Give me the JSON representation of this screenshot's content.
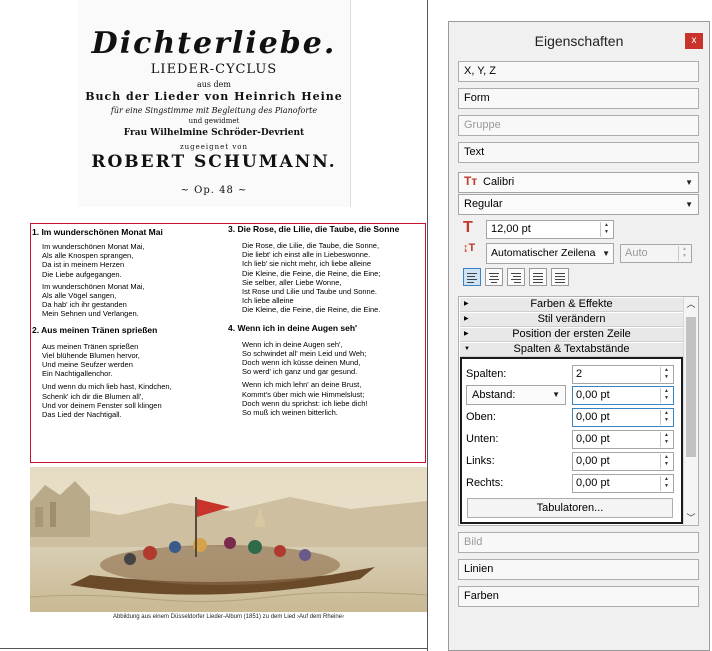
{
  "document": {
    "title_page": {
      "main_title": "Dichterliebe.",
      "subtitle": "LIEDER-CYCLUS",
      "line_aus": "aus dem",
      "book": "Buch der Lieder von Heinrich Heine",
      "voice": "für eine Singstimme mit Begleitung des Pianoforte",
      "dedication_pre": "Frau Wilhelmine Schröder-Devrient",
      "dedicated": "zugeeignet von",
      "composer": "ROBERT SCHUMANN.",
      "ornament": "~ Op. 48 ~"
    },
    "songs": [
      {
        "title": "1. Im wunderschönen Monat Mai",
        "stanzas": [
          [
            "Im wunderschönen Monat Mai,",
            "Als alle Knospen sprangen,",
            "Da ist in meinem Herzen",
            "Die Liebe aufgegangen."
          ],
          [
            "Im wunderschönen Monat Mai,",
            "Als alle Vögel sangen,",
            "Da hab' ich ihr gestanden",
            "Mein Sehnen und Verlangen."
          ]
        ]
      },
      {
        "title": "2. Aus meinen Tränen sprießen",
        "stanzas": [
          [
            "Aus meinen Tränen sprießen",
            "Viel blühende Blumen hervor,",
            "Und meine Seufzer werden",
            "Ein Nachtigallenchor."
          ],
          [
            "Und wenn du mich lieb hast, Kindchen,",
            "Schenk' ich dir die Blumen all',",
            "Und vor deinem Fenster soll klingen",
            "Das Lied der Nachtigall."
          ]
        ]
      },
      {
        "title": "3. Die Rose, die Lilie, die Taube, die Sonne",
        "stanzas": [
          [
            "Die Rose, die Lilie, die Taube, die Sonne,",
            "Die liebt' ich einst alle in Liebeswonne.",
            "Ich lieb' sie nicht mehr, ich liebe alleine",
            "Die Kleine, die Feine, die Reine, die Eine;",
            "Sie selber, aller Liebe Wonne,",
            "Ist Rose und Lilie und Taube und Sonne.",
            "Ich liebe alleine",
            "Die Kleine, die Feine, die Reine, die Eine."
          ]
        ]
      },
      {
        "title": "4. Wenn ich in deine Augen  seh'",
        "stanzas": [
          [
            "Wenn ich in deine Augen seh',",
            "So schwindet all' mein Leid und Weh;",
            "Doch wenn ich küsse deinen Mund,",
            "So werd' ich ganz und gar gesund."
          ],
          [
            "Wenn ich mich lehn' an deine Brust,",
            "Kommt's über mich wie Himmelslust;",
            "Doch wenn du sprichst: ich liebe dich!",
            "So muß ich weinen bitterlich."
          ]
        ]
      }
    ],
    "caption": "Abbildung aus einem Düsseldorfer Lieder-Album (1851) zu dem Lied ›Auf dem Rheine‹"
  },
  "panel": {
    "title": "Eigenschaften",
    "close_label": "x",
    "sections": {
      "xyz": "X, Y, Z",
      "form": "Form",
      "gruppe": "Gruppe",
      "text": "Text",
      "bild": "Bild",
      "linien": "Linien",
      "farben": "Farben"
    },
    "font_family": "Calibri",
    "font_style": "Regular",
    "font_size": "12,00 pt",
    "line_spacing_mode": "Automatischer Zeilena",
    "line_spacing_value": "Auto",
    "alignment_selected": "left",
    "accordion": {
      "items": [
        "Farben & Effekte",
        "Stil verändern",
        "Position der ersten Zeile",
        "Spalten & Textabstände"
      ],
      "expanded": "Spalten & Textabstände"
    },
    "columns": {
      "spalten_label": "Spalten:",
      "spalten_value": "2",
      "abstand_label": "Abstand:",
      "abstand_value": "0,00 pt",
      "oben_label": "Oben:",
      "oben_value": "0,00 pt",
      "unten_label": "Unten:",
      "unten_value": "0,00 pt",
      "links_label": "Links:",
      "links_value": "0,00 pt",
      "rechts_label": "Rechts:",
      "rechts_value": "0,00 pt",
      "tab_button": "Tabulatoren..."
    },
    "colors": {
      "frame_border": "#c8102e",
      "close_button": "#c8342c",
      "focus": "#3b82c4"
    }
  }
}
